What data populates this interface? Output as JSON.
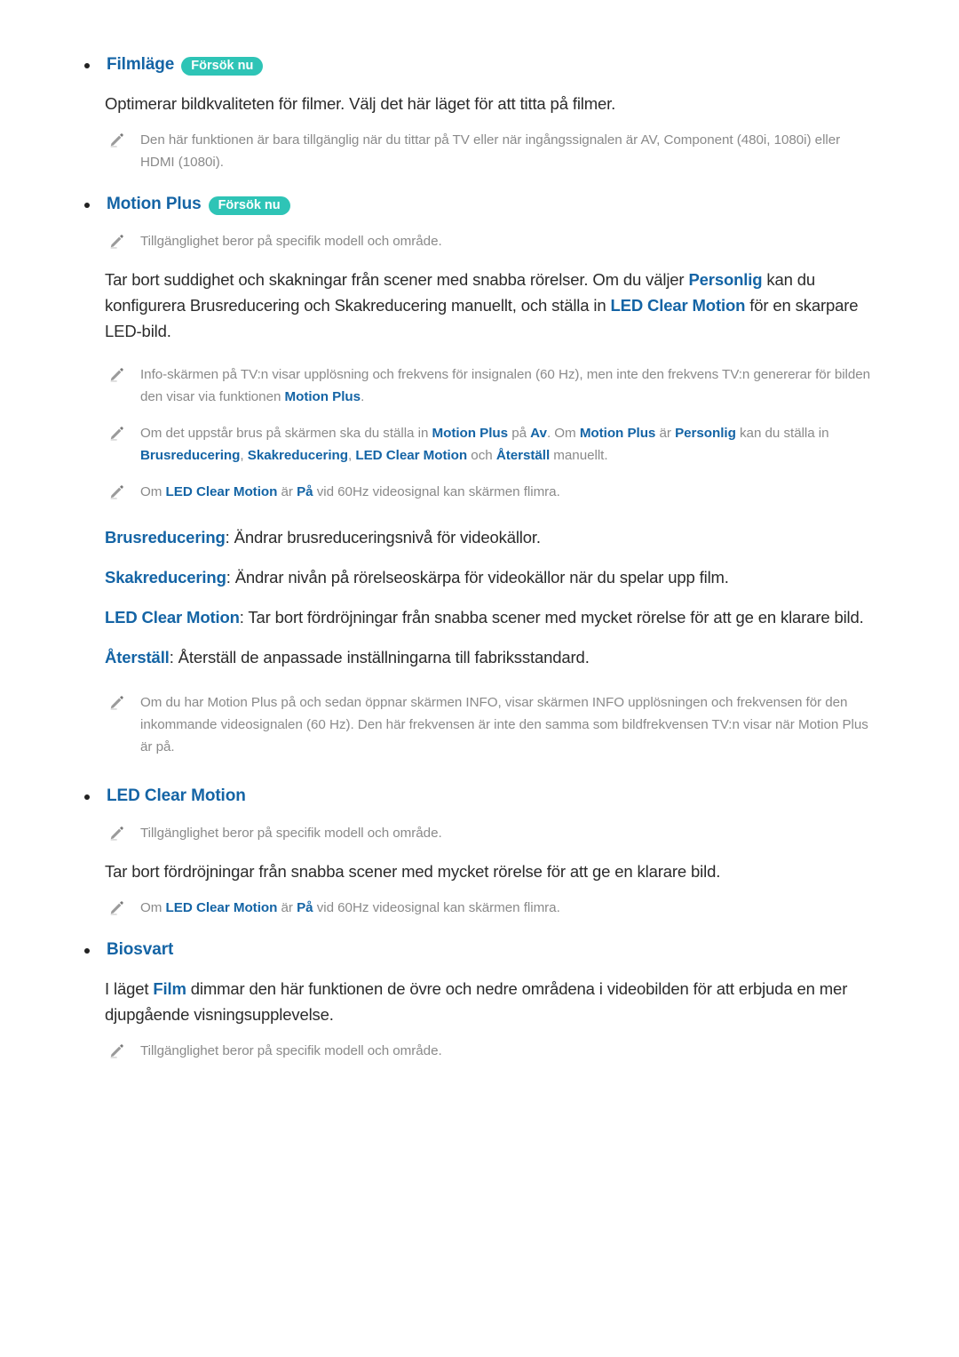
{
  "document": {
    "language": "sv",
    "colors": {
      "heading_blue": "#1464a5",
      "badge_teal": "#2ec4b6",
      "body_text": "#2b2b2b",
      "note_text": "#8a8a8a"
    },
    "badge_label": "Försök nu",
    "sections": [
      {
        "id": "filmlage",
        "heading": "Filmläge",
        "has_badge": true,
        "body": "Optimerar bildkvaliteten för filmer. Välj det här läget för att titta på filmer.",
        "note": {
          "part1": "Den här funktionen är bara tillgänglig när du tittar på TV eller när ingångssignalen är AV, Component (480i, 1080i) eller HDMI (1080i)."
        }
      },
      {
        "id": "motion-plus",
        "heading": "Motion Plus",
        "has_badge": true,
        "availability_note": "Tillgänglighet beror på specifik modell och område.",
        "body": {
          "p1": "Tar bort suddighet och skakningar från scener med snabba rörelser. Om du väljer ",
          "hl1": "Personlig",
          "p2": " kan du konfigurera Brusreducering och Skakreducering manuellt, och ställa in ",
          "hl2": "LED Clear Motion",
          "p3": " för en skarpare LED-bild."
        },
        "note1": {
          "p1": "Info-skärmen på TV:n visar upplösning och frekvens för insignalen (60 Hz), men inte den frekvens TV:n genererar för bilden den visar via funktionen ",
          "hl1": "Motion Plus",
          "p2": "."
        },
        "note2": {
          "p1": "Om det uppstår brus på skärmen ska du ställa in ",
          "hl1": "Motion Plus",
          "p2": " på ",
          "hl2": "Av",
          "p3": ". Om ",
          "hl3": "Motion Plus",
          "p4": " är ",
          "hl4": "Personlig",
          "p5": " kan du ställa in ",
          "hl5": "Brusreducering",
          "p6": ", ",
          "hl6": "Skakreducering",
          "p7": ", ",
          "hl7": "LED Clear Motion",
          "p8": " och ",
          "hl8": "Återställ",
          "p9": " manuellt."
        },
        "note3": {
          "p1": "Om ",
          "hl1": "LED Clear Motion",
          "p2": " är ",
          "hl2": "På",
          "p3": " vid 60Hz videosignal kan skärmen flimra."
        },
        "definitions": [
          {
            "term": "Brusreducering",
            "text": ": Ändrar brusreduceringsnivå för videokällor."
          },
          {
            "term": "Skakreducering",
            "text": ": Ändrar nivån på rörelseoskärpa för videokällor när du spelar upp film."
          },
          {
            "term": "LED Clear Motion",
            "text": ": Tar bort fördröjningar från snabba scener med mycket rörelse för att ge en klarare bild."
          },
          {
            "term": "Återställ",
            "text": ": Återställ de anpassade inställningarna till fabriksstandard."
          }
        ],
        "note4": "Om du har Motion Plus på och sedan öppnar skärmen INFO, visar skärmen INFO upplösningen och frekvensen för den inkommande videosignalen (60 Hz). Den här frekvensen är inte den samma som bildfrekvensen TV:n visar när Motion Plus är på."
      },
      {
        "id": "led-clear-motion",
        "heading": "LED Clear Motion",
        "has_badge": false,
        "availability_note": "Tillgänglighet beror på specifik modell och område.",
        "body": "Tar bort fördröjningar från snabba scener med mycket rörelse för att ge en klarare bild.",
        "note": {
          "p1": "Om ",
          "hl1": "LED Clear Motion",
          "p2": " är ",
          "hl2": "På",
          "p3": " vid 60Hz videosignal kan skärmen flimra."
        }
      },
      {
        "id": "biosvart",
        "heading": "Biosvart",
        "has_badge": false,
        "body": {
          "p1": "I läget ",
          "hl1": "Film",
          "p2": " dimmar den här funktionen de övre och nedre områdena i videobilden för att erbjuda en mer djupgående visningsupplevelse."
        },
        "availability_note": "Tillgänglighet beror på specifik modell och område."
      }
    ]
  }
}
